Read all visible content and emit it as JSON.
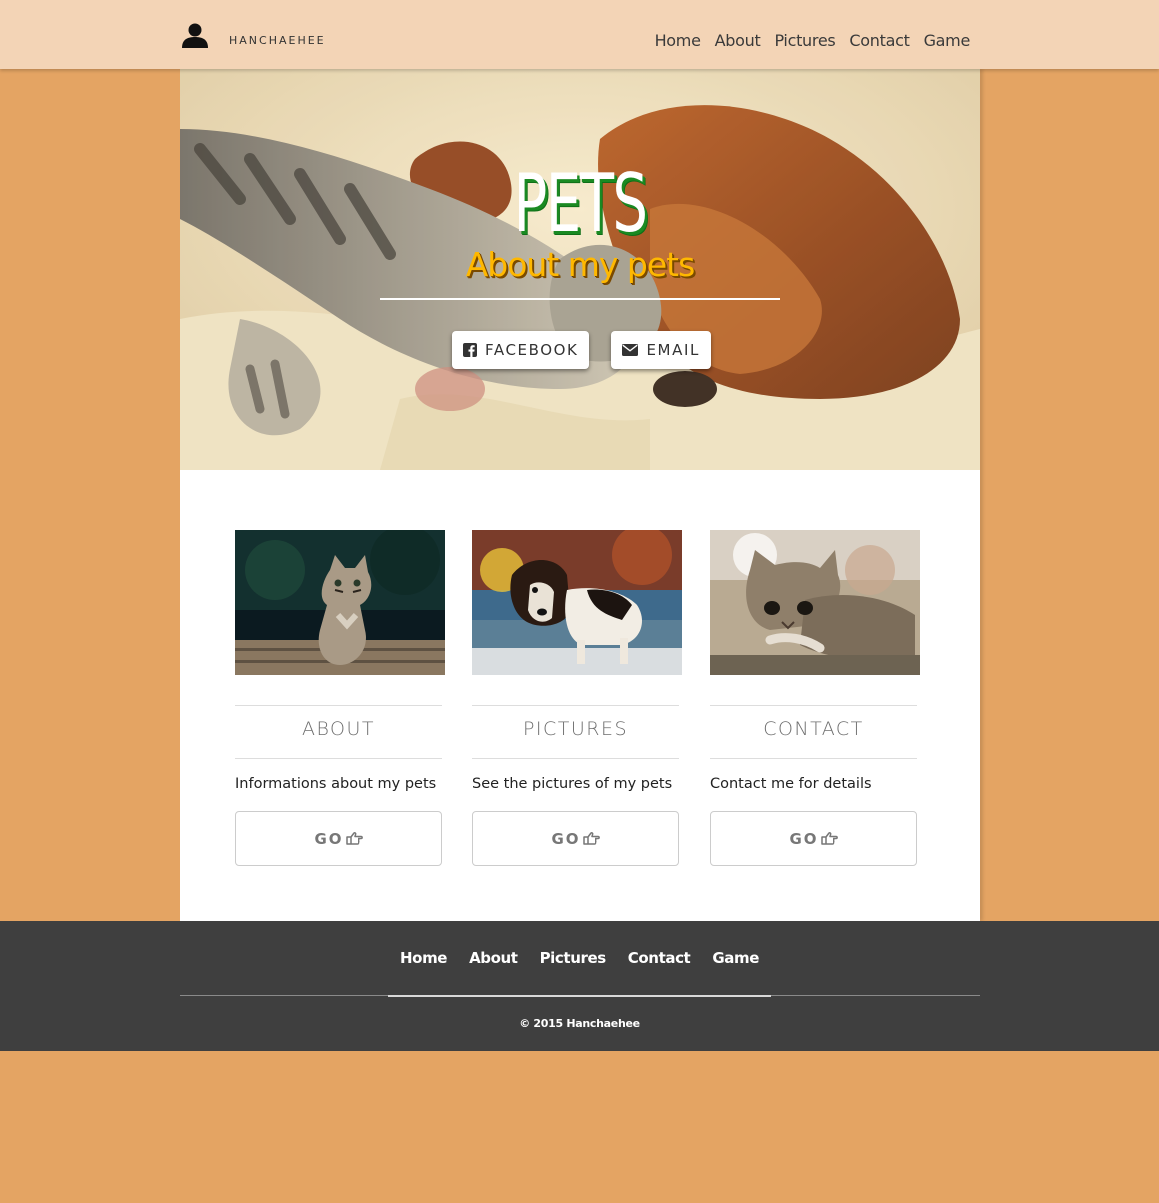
{
  "brand": {
    "name": "HANCHAEHEE",
    "icon": "user-silhouette-icon"
  },
  "nav": {
    "items": [
      {
        "label": "Home"
      },
      {
        "label": "About"
      },
      {
        "label": "Pictures"
      },
      {
        "label": "Contact"
      },
      {
        "label": "Game"
      }
    ]
  },
  "hero": {
    "title": "PETS",
    "subtitle": "About my pets",
    "buttons": [
      {
        "label": "FACEBOOK",
        "icon": "facebook-icon"
      },
      {
        "label": "EMAIL",
        "icon": "envelope-icon"
      }
    ]
  },
  "cards": [
    {
      "heading": "ABOUT",
      "description": "Informations about my pets",
      "button": "GO",
      "image": "kitten-praying"
    },
    {
      "heading": "PICTURES",
      "description": "See the pictures of my pets",
      "button": "GO",
      "image": "beagle-puppy"
    },
    {
      "heading": "CONTACT",
      "description": "Contact me for details",
      "button": "GO",
      "image": "tabby-kitten-lying"
    }
  ],
  "footer": {
    "links": [
      {
        "label": "Home"
      },
      {
        "label": "About"
      },
      {
        "label": "Pictures"
      },
      {
        "label": "Contact"
      },
      {
        "label": "Game"
      }
    ],
    "copyright": "© 2015 Hanchaehee"
  },
  "colors": {
    "page_background": "#e4a463",
    "navbar": "#f3d4b6",
    "footer": "#3f3f3f",
    "hero_title": "#ffffff",
    "hero_title_shadow": "#1a8a22",
    "hero_subtitle": "#ffb800"
  }
}
